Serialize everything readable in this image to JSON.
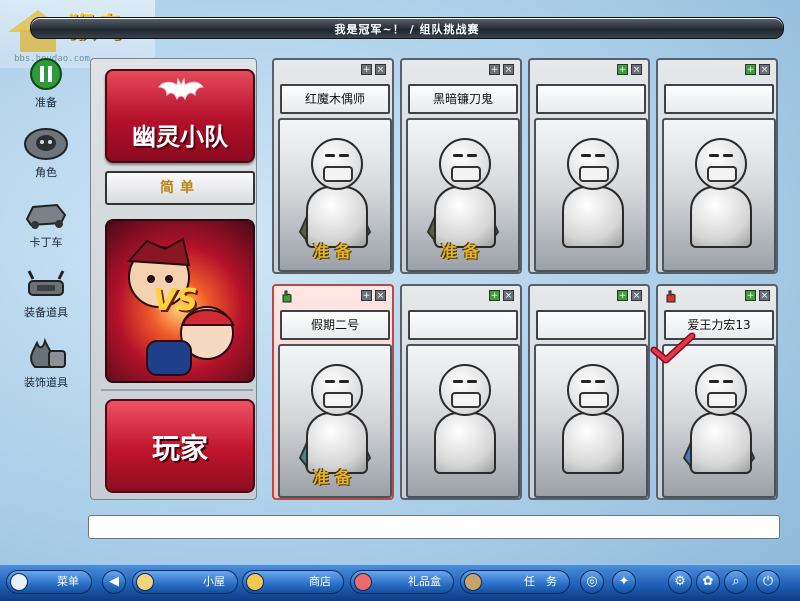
{
  "window": {
    "title": "我是冠军~！ / 组队挑战赛"
  },
  "logo": {
    "text": "猴岛",
    "url": "bbs.houdao.com"
  },
  "nav": [
    {
      "label": "准备",
      "icon": "pause-icon"
    },
    {
      "label": "角色",
      "icon": "character-icon"
    },
    {
      "label": "卡丁车",
      "icon": "kart-icon"
    },
    {
      "label": "装备道具",
      "icon": "equipment-icon"
    },
    {
      "label": "装饰道具",
      "icon": "decoration-icon"
    }
  ],
  "team": {
    "name": "幽灵小队",
    "difficulty": "简单",
    "player_label": "玩家",
    "vs": "VS"
  },
  "slots": [
    {
      "name": "红魔木偶师",
      "status": "准备",
      "kart": true,
      "active": false,
      "hand": false,
      "checked": false
    },
    {
      "name": "黑暗镰刀鬼",
      "status": "准备",
      "kart": true,
      "active": false,
      "hand": false,
      "checked": false
    },
    {
      "name": "",
      "status": "",
      "kart": false,
      "active": false,
      "hand": false,
      "checked": false
    },
    {
      "name": "",
      "status": "",
      "kart": false,
      "active": false,
      "hand": false,
      "checked": false
    },
    {
      "name": "假期二号",
      "status": "准备",
      "kart": true,
      "active": true,
      "hand": true,
      "checked": false
    },
    {
      "name": "",
      "status": "",
      "kart": false,
      "active": false,
      "hand": false,
      "checked": false
    },
    {
      "name": "",
      "status": "",
      "kart": false,
      "active": false,
      "hand": false,
      "checked": false
    },
    {
      "name": "爱王力宏13",
      "status": "",
      "kart": true,
      "active": false,
      "hand": true,
      "checked": true
    }
  ],
  "chat": {
    "value": ""
  },
  "taskbar": {
    "menu": "菜单",
    "house": "小屋",
    "shop": "商店",
    "gift": "礼品盒",
    "task": "任　务"
  },
  "colors": {
    "accent": "#c0142c",
    "taskbar": "#1f5fb5",
    "ready": "#e4b52a"
  }
}
